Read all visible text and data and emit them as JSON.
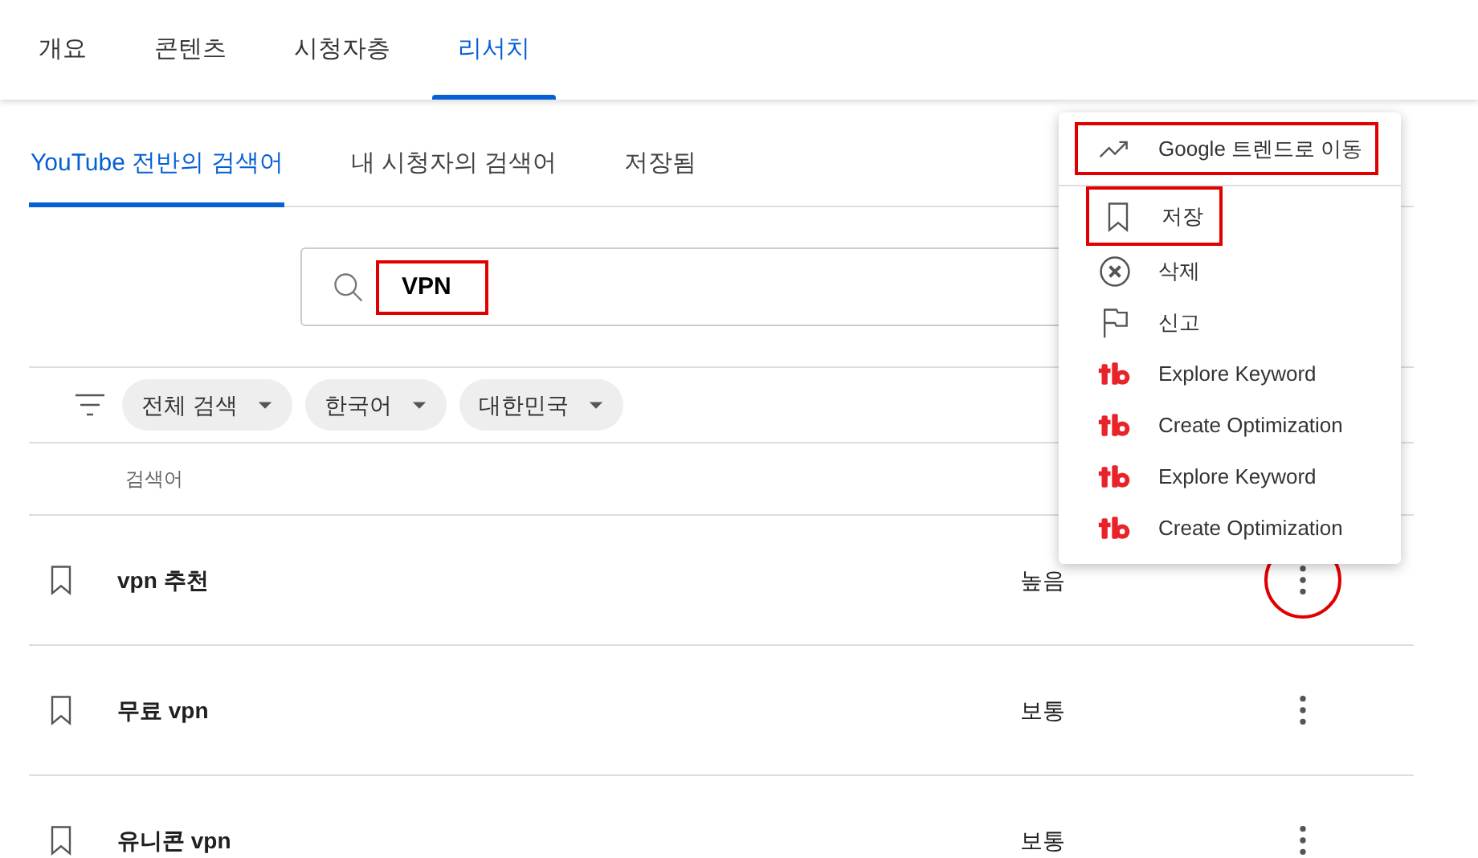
{
  "main_tabs": [
    {
      "label": "개요",
      "selected": false
    },
    {
      "label": "콘텐츠",
      "selected": false
    },
    {
      "label": "시청자층",
      "selected": false
    },
    {
      "label": "리서치",
      "selected": true
    }
  ],
  "sub_tabs": [
    {
      "label": "YouTube 전반의 검색어",
      "selected": true
    },
    {
      "label": "내 시청자의 검색어",
      "selected": false
    },
    {
      "label": "저장됨",
      "selected": false
    }
  ],
  "search": {
    "value": "VPN",
    "highlighted": true
  },
  "filters": [
    {
      "label": "전체 검색"
    },
    {
      "label": "한국어"
    },
    {
      "label": "대한민국"
    }
  ],
  "table": {
    "columns": [
      "검색어"
    ],
    "rows": [
      {
        "keyword": "vpn 추천",
        "level_text": "높음",
        "saved": false,
        "highlighted": true
      },
      {
        "keyword": "무료 vpn",
        "level_text": "보통",
        "saved": false,
        "highlighted": false
      },
      {
        "keyword": "유니콘 vpn",
        "level_text": "보통",
        "saved": false,
        "highlighted": false
      }
    ]
  },
  "menu": {
    "items": [
      {
        "kind": "trends",
        "label": "Google 트렌드로 이동",
        "highlighted": true
      },
      {
        "kind": "bookmark",
        "label": "저장",
        "highlighted": true
      },
      {
        "kind": "delete",
        "label": "삭제",
        "highlighted": false
      },
      {
        "kind": "flag",
        "label": "신고",
        "highlighted": false
      },
      {
        "kind": "tubebuddy",
        "label": "Explore Keyword",
        "highlighted": false
      },
      {
        "kind": "tubebuddy",
        "label": "Create Optimization",
        "highlighted": false
      },
      {
        "kind": "tubebuddy",
        "label": "Explore Keyword",
        "highlighted": false
      },
      {
        "kind": "tubebuddy",
        "label": "Create Optimization",
        "highlighted": false
      }
    ]
  }
}
